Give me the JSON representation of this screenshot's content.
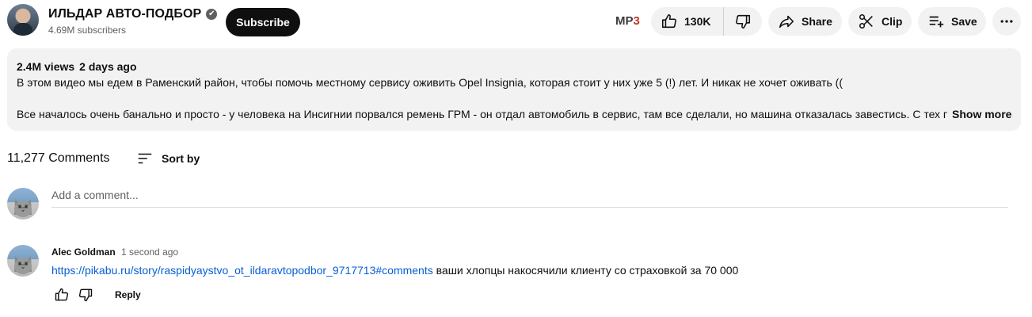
{
  "channel": {
    "name": "ИЛЬДАР АВТО-ПОДБОР",
    "verified_mark": "✔",
    "subscribers": "4.69M subscribers",
    "subscribe_label": "Subscribe"
  },
  "actions": {
    "mp3_prefix": "MP",
    "mp3_accent": "3",
    "likes": "130K",
    "share_label": "Share",
    "clip_label": "Clip",
    "save_label": "Save",
    "icons": [
      "thumbs-up-icon",
      "thumbs-down-icon",
      "share-arrow-icon",
      "scissors-icon",
      "playlist-add-icon",
      "more-horizontal-icon"
    ]
  },
  "description": {
    "views": "2.4M views",
    "date": "2 days ago",
    "line1": "В этом видео мы едем в Раменский район, чтобы помочь местному сервису оживить Opel Insignia, которая стоит у них уже 5 (!) лет. И никак не хочет оживать ((",
    "line2": "Все началось очень банально и просто - у человека на Инсигнии порвался ремень ГРМ - он отдал автомобиль в сервис, там все сделали, но машина отказалась завестись. С тех пор",
    "show_more": "Show more"
  },
  "comments_header": {
    "count": "11,277 Comments",
    "sort_label": "Sort by"
  },
  "add_comment": {
    "placeholder": "Add a comment..."
  },
  "comments": [
    {
      "author": "Alec Goldman",
      "time": "1 second ago",
      "link": "https://pikabu.ru/story/raspidyaystvo_ot_ildaravtopodbor_9717713#comments",
      "text": " ваши хлопцы накосячили клиенту со страховкой за 70 000",
      "reply_label": "Reply"
    }
  ],
  "colors": {
    "link": "#065fd4",
    "pill_bg": "#f2f2f2",
    "subscribe_bg": "#0f0f0f",
    "secondary_text": "#606060",
    "mp3_accent": "#c0392b"
  }
}
